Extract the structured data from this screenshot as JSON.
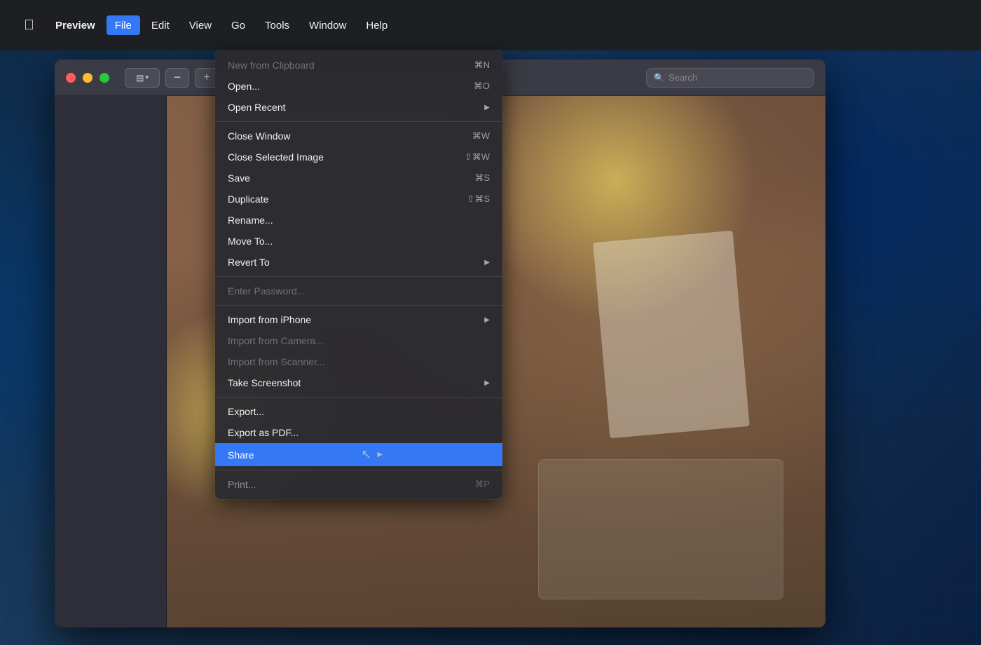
{
  "menubar": {
    "apple_label": "",
    "items": [
      {
        "id": "preview",
        "label": "Preview",
        "active": false,
        "bold": true
      },
      {
        "id": "file",
        "label": "File",
        "active": true
      },
      {
        "id": "edit",
        "label": "Edit",
        "active": false
      },
      {
        "id": "view",
        "label": "View",
        "active": false
      },
      {
        "id": "go",
        "label": "Go",
        "active": false
      },
      {
        "id": "tools",
        "label": "Tools",
        "active": false
      },
      {
        "id": "window",
        "label": "Window",
        "active": false
      },
      {
        "id": "help",
        "label": "Help",
        "active": false
      }
    ]
  },
  "toolbar": {
    "sidebar_icon": "▤",
    "zoom_out_icon": "−",
    "zoom_in_icon": "+",
    "search_placeholder": "Search"
  },
  "file_menu": {
    "items": [
      {
        "id": "new-clipboard",
        "label": "New from Clipboard",
        "shortcut": "⌘N",
        "disabled": true,
        "has_arrow": false
      },
      {
        "id": "open",
        "label": "Open...",
        "shortcut": "⌘O",
        "disabled": false,
        "has_arrow": false
      },
      {
        "id": "open-recent",
        "label": "Open Recent",
        "shortcut": "",
        "disabled": false,
        "has_arrow": true
      },
      {
        "id": "sep1",
        "type": "separator"
      },
      {
        "id": "close-window",
        "label": "Close Window",
        "shortcut": "⌘W",
        "disabled": false,
        "has_arrow": false
      },
      {
        "id": "close-selected",
        "label": "Close Selected Image",
        "shortcut": "⇧⌘W",
        "disabled": false,
        "has_arrow": false
      },
      {
        "id": "save",
        "label": "Save",
        "shortcut": "⌘S",
        "disabled": false,
        "has_arrow": false
      },
      {
        "id": "duplicate",
        "label": "Duplicate",
        "shortcut": "⇧⌘S",
        "disabled": false,
        "has_arrow": false
      },
      {
        "id": "rename",
        "label": "Rename...",
        "shortcut": "",
        "disabled": false,
        "has_arrow": false
      },
      {
        "id": "move-to",
        "label": "Move To...",
        "shortcut": "",
        "disabled": false,
        "has_arrow": false
      },
      {
        "id": "revert-to",
        "label": "Revert To",
        "shortcut": "",
        "disabled": false,
        "has_arrow": true
      },
      {
        "id": "sep2",
        "type": "separator"
      },
      {
        "id": "enter-password",
        "label": "Enter Password...",
        "shortcut": "",
        "disabled": true,
        "has_arrow": false
      },
      {
        "id": "sep3",
        "type": "separator"
      },
      {
        "id": "import-iphone",
        "label": "Import from iPhone",
        "shortcut": "",
        "disabled": false,
        "has_arrow": true
      },
      {
        "id": "import-camera",
        "label": "Import from Camera...",
        "shortcut": "",
        "disabled": true,
        "has_arrow": false
      },
      {
        "id": "import-scanner",
        "label": "Import from Scanner...",
        "shortcut": "",
        "disabled": true,
        "has_arrow": false
      },
      {
        "id": "take-screenshot",
        "label": "Take Screenshot",
        "shortcut": "",
        "disabled": false,
        "has_arrow": true
      },
      {
        "id": "sep4",
        "type": "separator"
      },
      {
        "id": "export",
        "label": "Export...",
        "shortcut": "",
        "disabled": false,
        "has_arrow": false
      },
      {
        "id": "export-pdf",
        "label": "Export as PDF...",
        "shortcut": "",
        "disabled": false,
        "has_arrow": false
      },
      {
        "id": "share",
        "label": "Share",
        "shortcut": "",
        "disabled": false,
        "has_arrow": true,
        "highlighted": true
      },
      {
        "id": "sep5",
        "type": "separator"
      },
      {
        "id": "print",
        "label": "Print...",
        "shortcut": "⌘P",
        "disabled": false,
        "has_arrow": false
      }
    ]
  }
}
